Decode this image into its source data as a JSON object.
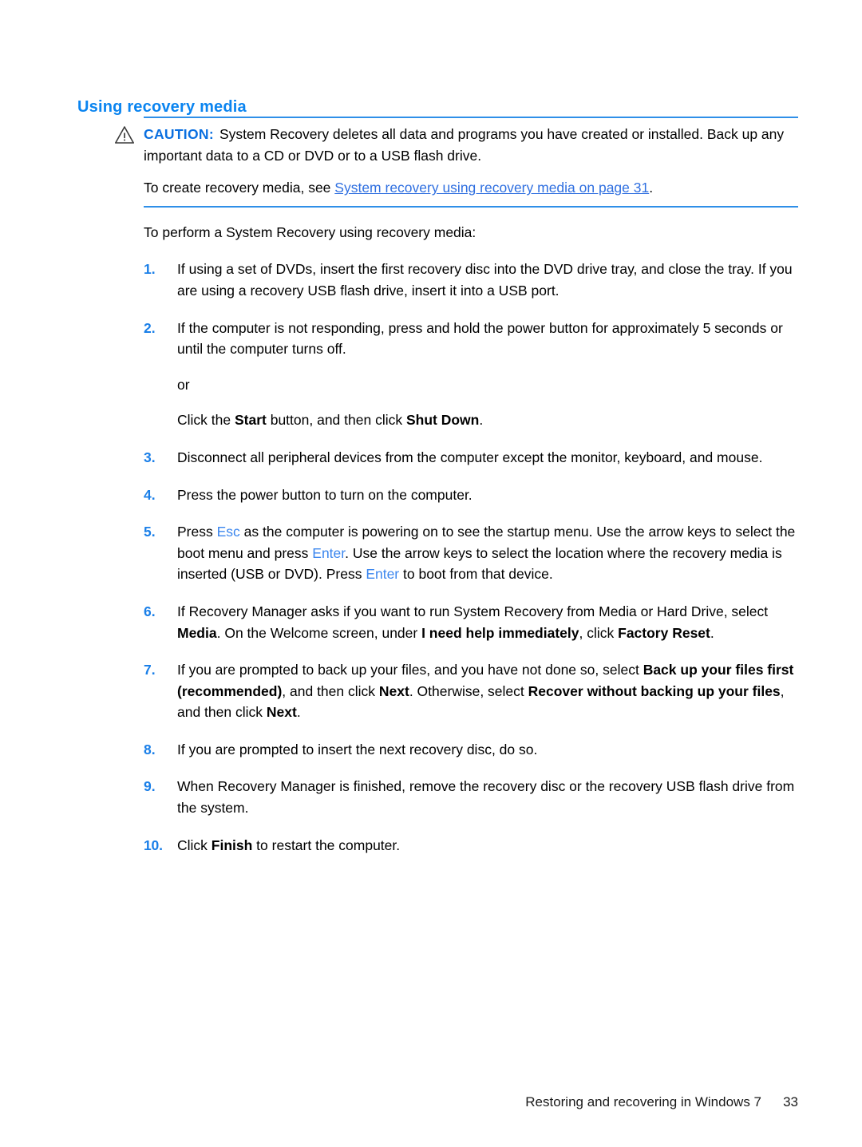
{
  "heading": "Using recovery media",
  "note": {
    "icon": "caution-triangle-icon",
    "label": "CAUTION:",
    "text": "System Recovery deletes all data and programs you have created or installed. Back up any important data to a CD or DVD or to a USB flash drive.",
    "link_lead": "To create recovery media, see ",
    "link_text": "System recovery using recovery media on page 31",
    "link_tail": "."
  },
  "intro": "To perform a System Recovery using recovery media:",
  "steps": [
    {
      "num": "1.",
      "parts": [
        {
          "t": "If using a set of DVDs, insert the first recovery disc into the DVD drive tray, and close the tray. If you are using a recovery USB flash drive, insert it into a USB port.",
          "s": "plain"
        }
      ]
    },
    {
      "num": "2.",
      "parts": [
        {
          "t": "If the computer is not responding, press and hold the power button for approximately 5 seconds or until the computer turns off.",
          "s": "plain"
        }
      ],
      "sub": [
        [
          {
            "t": "or",
            "s": "plain"
          }
        ],
        [
          {
            "t": "Click the ",
            "s": "plain"
          },
          {
            "t": "Start",
            "s": "bold"
          },
          {
            "t": " button, and then click ",
            "s": "plain"
          },
          {
            "t": "Shut Down",
            "s": "bold"
          },
          {
            "t": ".",
            "s": "plain"
          }
        ]
      ]
    },
    {
      "num": "3.",
      "parts": [
        {
          "t": "Disconnect all peripheral devices from the computer except the monitor, keyboard, and mouse.",
          "s": "plain"
        }
      ]
    },
    {
      "num": "4.",
      "parts": [
        {
          "t": "Press the power button to turn on the computer.",
          "s": "plain"
        }
      ]
    },
    {
      "num": "5.",
      "parts": [
        {
          "t": "Press ",
          "s": "plain"
        },
        {
          "t": "Esc",
          "s": "key"
        },
        {
          "t": " as the computer is powering on to see the startup menu. Use the arrow keys to select the boot menu and press ",
          "s": "plain"
        },
        {
          "t": "Enter",
          "s": "key"
        },
        {
          "t": ". Use the arrow keys to select the location where the recovery media is inserted (USB or DVD). Press ",
          "s": "plain"
        },
        {
          "t": "Enter",
          "s": "key"
        },
        {
          "t": " to boot from that device.",
          "s": "plain"
        }
      ]
    },
    {
      "num": "6.",
      "parts": [
        {
          "t": "If Recovery Manager asks if you want to run System Recovery from Media or Hard Drive, select ",
          "s": "plain"
        },
        {
          "t": "Media",
          "s": "bold"
        },
        {
          "t": ". On the Welcome screen, under ",
          "s": "plain"
        },
        {
          "t": "I need help immediately",
          "s": "bold"
        },
        {
          "t": ", click ",
          "s": "plain"
        },
        {
          "t": "Factory Reset",
          "s": "bold"
        },
        {
          "t": ".",
          "s": "plain"
        }
      ]
    },
    {
      "num": "7.",
      "parts": [
        {
          "t": "If you are prompted to back up your files, and you have not done so, select ",
          "s": "plain"
        },
        {
          "t": "Back up your files first (recommended)",
          "s": "bold"
        },
        {
          "t": ", and then click ",
          "s": "plain"
        },
        {
          "t": "Next",
          "s": "bold"
        },
        {
          "t": ". Otherwise, select ",
          "s": "plain"
        },
        {
          "t": "Recover without backing up your files",
          "s": "bold"
        },
        {
          "t": ", and then click ",
          "s": "plain"
        },
        {
          "t": "Next",
          "s": "bold"
        },
        {
          "t": ".",
          "s": "plain"
        }
      ]
    },
    {
      "num": "8.",
      "parts": [
        {
          "t": "If you are prompted to insert the next recovery disc, do so.",
          "s": "plain"
        }
      ]
    },
    {
      "num": "9.",
      "parts": [
        {
          "t": "When Recovery Manager is finished, remove the recovery disc or the recovery USB flash drive from the system.",
          "s": "plain"
        }
      ]
    },
    {
      "num": "10.",
      "parts": [
        {
          "t": "Click ",
          "s": "plain"
        },
        {
          "t": "Finish",
          "s": "bold"
        },
        {
          "t": " to restart the computer.",
          "s": "plain"
        }
      ]
    }
  ],
  "footer": {
    "title": "Restoring and recovering in Windows 7",
    "page": "33"
  },
  "colors": {
    "heading_blue": "#0a84f0",
    "note_rule_blue": "#2f8fe8",
    "link_blue": "#2f6fe0",
    "number_blue": "#1a7fe8",
    "key_blue": "#3b86ee",
    "text_black": "#000000",
    "background": "#ffffff"
  }
}
